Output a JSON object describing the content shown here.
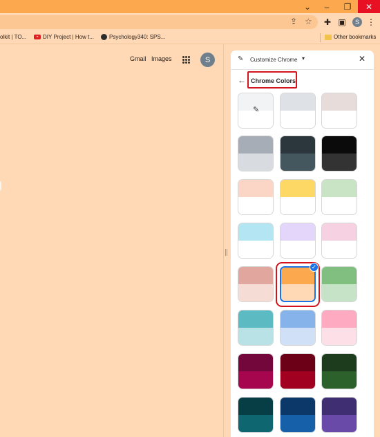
{
  "window": {
    "minimize_glyph": "–",
    "restore_glyph": "❐",
    "close_glyph": "✕"
  },
  "toolbar": {
    "avatar_letter": "S"
  },
  "bookmarks": {
    "items": [
      {
        "label": "olkit | TO..."
      },
      {
        "label": "DIY Project | How t..."
      },
      {
        "label": "Psychology340: SPS..."
      }
    ],
    "other_label": "Other bookmarks"
  },
  "ntp": {
    "gmail": "Gmail",
    "images": "Images",
    "avatar_letter": "S"
  },
  "panel": {
    "header_title": "Customize Chrome",
    "section_title": "Chrome Colors",
    "colors": [
      {
        "top": "#f1f3f4",
        "bottom": "#ffffff",
        "custom": true
      },
      {
        "top": "#dee1e6",
        "bottom": "#ffffff"
      },
      {
        "top": "#e8dcda",
        "bottom": "#ffffff"
      },
      {
        "top": "#a7adb7",
        "bottom": "#d8dbe0"
      },
      {
        "top": "#2c373d",
        "bottom": "#45575e"
      },
      {
        "top": "#0b0b0b",
        "bottom": "#333333"
      },
      {
        "top": "#fbd6c6",
        "bottom": "#ffffff"
      },
      {
        "top": "#fdd865",
        "bottom": "#ffffff"
      },
      {
        "top": "#c9e4c5",
        "bottom": "#ffffff"
      },
      {
        "top": "#b3e6f2",
        "bottom": "#ffffff"
      },
      {
        "top": "#e3d6fa",
        "bottom": "#ffffff"
      },
      {
        "top": "#f6d1e1",
        "bottom": "#ffffff"
      },
      {
        "top": "#e1a79f",
        "bottom": "#f5ddd6"
      },
      {
        "top": "#fca84f",
        "bottom": "#ffd8b6",
        "selected": true
      },
      {
        "top": "#80bf80",
        "bottom": "#c7e3c7"
      },
      {
        "top": "#5cbac3",
        "bottom": "#b8e2e5"
      },
      {
        "top": "#86b3ea",
        "bottom": "#cfe0f7"
      },
      {
        "top": "#feaac0",
        "bottom": "#fde0e7"
      },
      {
        "top": "#73073c",
        "bottom": "#a6064e"
      },
      {
        "top": "#6b0016",
        "bottom": "#a20020"
      },
      {
        "top": "#1d3b1d",
        "bottom": "#2c612c"
      },
      {
        "top": "#073d44",
        "bottom": "#0e6670"
      },
      {
        "top": "#0c3769",
        "bottom": "#1560a8"
      },
      {
        "top": "#3f2e72",
        "bottom": "#6a4aa8"
      }
    ]
  }
}
